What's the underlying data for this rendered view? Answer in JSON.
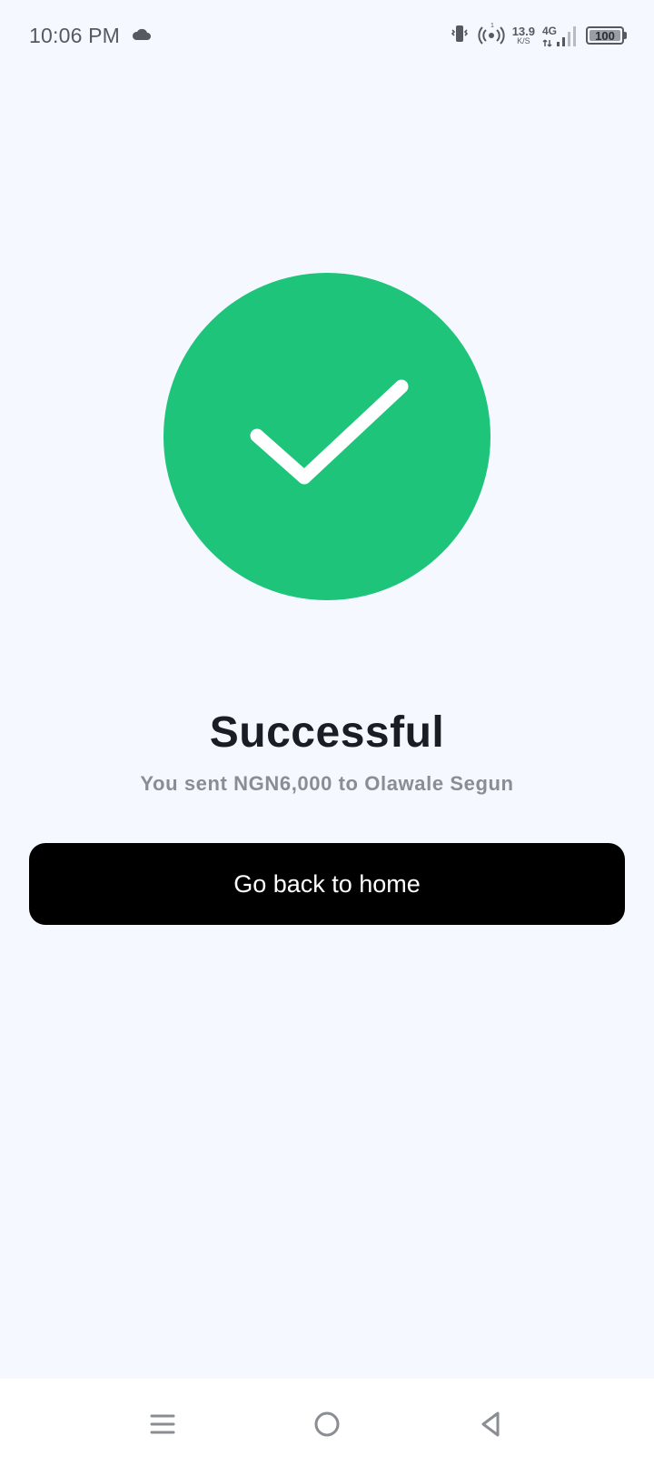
{
  "status_bar": {
    "time": "10:06 PM",
    "speed_value": "13.9",
    "speed_unit": "K/S",
    "network": "4G",
    "battery_level": "100",
    "icons": [
      "cloud-icon",
      "vibrate-icon",
      "hotspot-icon",
      "signal-icon",
      "battery-icon"
    ]
  },
  "result": {
    "icon": "check-icon",
    "accent_color": "#1ec47a",
    "title": "Successful",
    "message": "You sent NGN6,000 to Olawale Segun"
  },
  "actions": {
    "home_button_label": "Go back to home"
  },
  "nav_bar": {
    "icons": [
      "menu-icon",
      "home-circle-icon",
      "back-triangle-icon"
    ]
  }
}
